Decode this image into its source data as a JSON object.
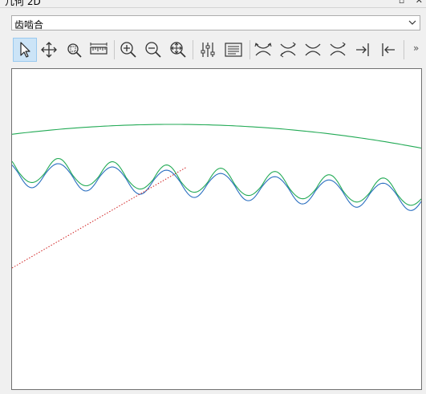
{
  "window": {
    "title": "几何 2D"
  },
  "mesh_selector": {
    "value": "齿啮合"
  },
  "toolbar": {
    "tools": [
      {
        "name": "select-tool-button",
        "icon": "cursor-arrow-icon",
        "active": true
      },
      {
        "name": "pan-tool-button",
        "icon": "move-arrows-icon",
        "active": false
      },
      {
        "name": "zoom-box-button",
        "icon": "zoom-box-icon",
        "active": false
      },
      {
        "name": "measure-button",
        "icon": "ruler-icon",
        "active": false
      },
      {
        "name": "zoom-in-button",
        "icon": "zoom-in-icon",
        "active": false
      },
      {
        "name": "zoom-out-button",
        "icon": "zoom-out-icon",
        "active": false
      },
      {
        "name": "zoom-extents-button",
        "icon": "zoom-extents-icon",
        "active": false
      },
      {
        "name": "settings-sliders-button",
        "icon": "sliders-icon",
        "active": false
      },
      {
        "name": "report-button",
        "icon": "text-lines-icon",
        "active": false
      },
      {
        "name": "view-flank-1-button",
        "icon": "flank-in-icon",
        "active": false
      },
      {
        "name": "view-flank-2-button",
        "icon": "flank-out-icon",
        "active": false
      },
      {
        "name": "view-flank-3-button",
        "icon": "flank-in-b-icon",
        "active": false
      },
      {
        "name": "view-flank-4-button",
        "icon": "flank-out-b-icon",
        "active": false
      },
      {
        "name": "align-right-button",
        "icon": "arrow-to-bar-right-icon",
        "active": false
      },
      {
        "name": "align-left-button",
        "icon": "arrow-to-bar-left-icon",
        "active": false
      }
    ],
    "more_label": "»"
  },
  "colors": {
    "outer_circle": "#22aa55",
    "gear_green": "#22aa55",
    "gear_blue": "#2a6fc0",
    "dotted_line": "#d02020"
  }
}
